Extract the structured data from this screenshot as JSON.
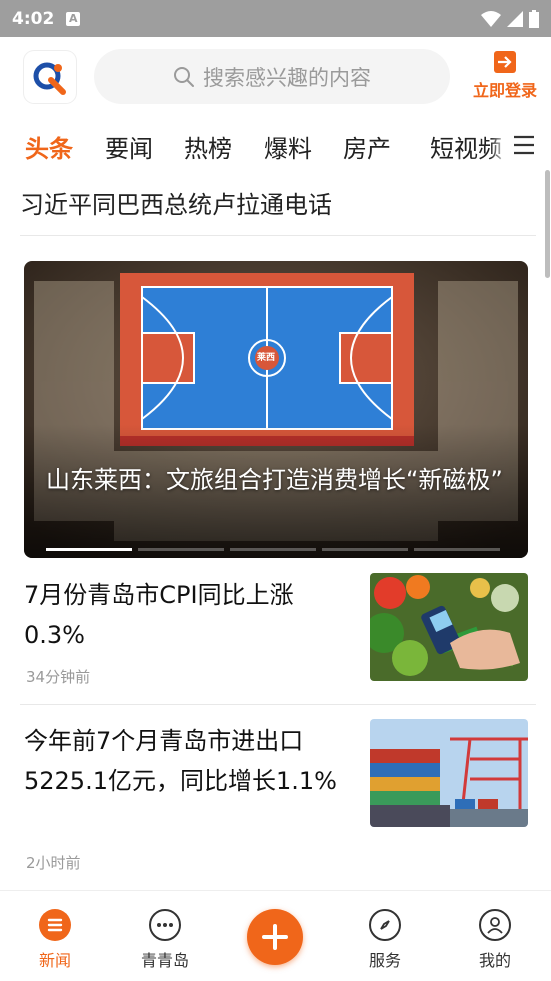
{
  "status_bar": {
    "time": "4:02",
    "badge": "A"
  },
  "header": {
    "search_placeholder": "搜索感兴趣的内容",
    "login_label": "立即登录"
  },
  "tabs": [
    {
      "label": "头条",
      "active": true
    },
    {
      "label": "要闻",
      "active": false
    },
    {
      "label": "热榜",
      "active": false
    },
    {
      "label": "爆料",
      "active": false
    },
    {
      "label": "房产",
      "active": false
    },
    {
      "label": "短视频",
      "active": false
    }
  ],
  "headline": "习近平同巴西总统卢拉通电话",
  "hero": {
    "caption": "山东莱西：文旅组合打造消费增长“新磁极”",
    "court_logo_text": "莱西",
    "slides": 5,
    "active_slide": 1
  },
  "news": [
    {
      "title": "7月份青岛市CPI同比上涨0.3%",
      "time": "34分钟前",
      "thumb": "vegetables-payment-photo"
    },
    {
      "title": "今年前7个月青岛市进出口5225.1亿元，同比增长1.1%",
      "time": "2小时前",
      "thumb": "container-port-photo"
    }
  ],
  "bottom_nav": [
    {
      "label": "新闻",
      "icon": "news-icon",
      "active": true
    },
    {
      "label": "青青岛",
      "icon": "chat-icon",
      "active": false
    },
    {
      "label": "服务",
      "icon": "compass-icon",
      "active": false
    },
    {
      "label": "我的",
      "icon": "user-icon",
      "active": false
    }
  ],
  "colors": {
    "accent": "#f0661a",
    "status_bar": "#9e9e9e"
  }
}
